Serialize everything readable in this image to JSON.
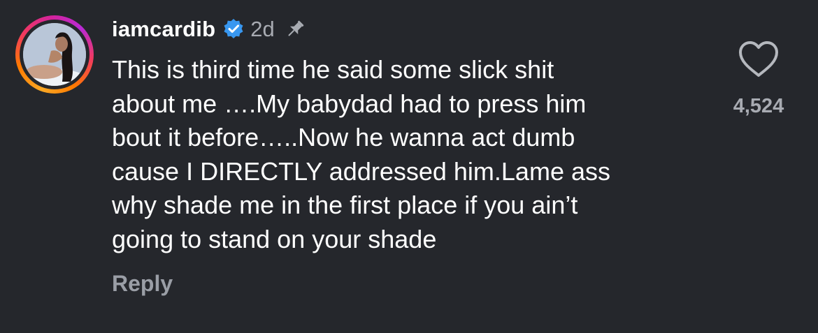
{
  "comment": {
    "username": "iamcardib",
    "verified_icon": "verified-badge-icon",
    "timestamp": "2d",
    "pin_icon": "pin-icon",
    "body_lines": [
      "This is third time he said some slick shit",
      "about me ….My babydad had to press him",
      "bout it before…..Now he wanna act dumb",
      "cause I DIRECTLY addressed him.Lame ass",
      "why shade me in the first place if you ain’t",
      "going to stand on your shade"
    ],
    "reply_label": "Reply",
    "like_icon": "heart-icon",
    "like_count": "4,524"
  },
  "colors": {
    "background": "#25272c",
    "text_primary": "#ffffff",
    "text_secondary": "#a8abb2",
    "verified_blue": "#3897f0"
  }
}
